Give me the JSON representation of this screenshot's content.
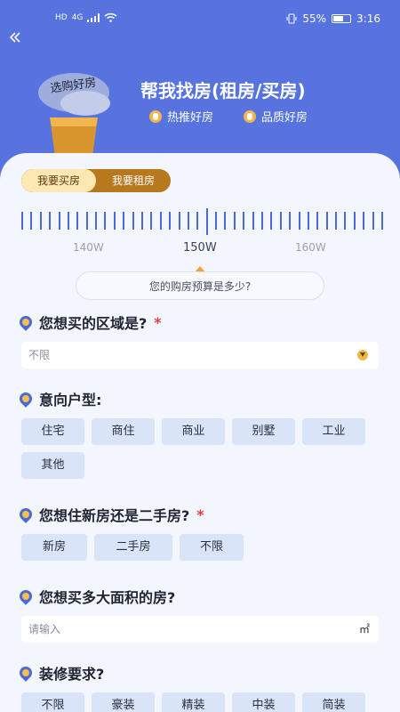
{
  "status_bar": {
    "network_hd": "HD",
    "network_type": "4G",
    "battery_percent": "55%",
    "time": "3:16",
    "battery_level": 0.55
  },
  "header": {
    "back_icon": "double-chevron-left-icon",
    "title": "帮我找房(租房/买房)",
    "hero_text": "选购好房",
    "tags": [
      "热推好房",
      "品质好房"
    ]
  },
  "mode_toggle": {
    "options": [
      "我要买房",
      "我要租房"
    ],
    "selected": "我要买房"
  },
  "budget": {
    "ruler_labels": [
      "140W",
      "150W",
      "160W"
    ],
    "selected": "150W",
    "question": "您的购房预算是多少?"
  },
  "area": {
    "title": "您想买的区域是?",
    "required_mark": "*",
    "value": "不限"
  },
  "house_type": {
    "title": "意向户型:",
    "options": [
      "住宅",
      "商住",
      "商业",
      "别墅",
      "工业",
      "其他"
    ]
  },
  "new_or_second": {
    "title": "您想住新房还是二手房?",
    "required_mark": "*",
    "options": [
      "新房",
      "二手房",
      "不限"
    ]
  },
  "size": {
    "title": "您想买多大面积的房?",
    "placeholder": "请输入",
    "unit": "㎡"
  },
  "decoration": {
    "title": "装修要求?",
    "options": [
      "不限",
      "豪装",
      "精装",
      "中装",
      "简装"
    ]
  },
  "colors": {
    "brand_blue": "#5673df",
    "card_bg": "#f3f6fd",
    "chip_bg": "#d9e4f8",
    "accent_gold": "#b7781e",
    "required_red": "#e83b3b"
  }
}
